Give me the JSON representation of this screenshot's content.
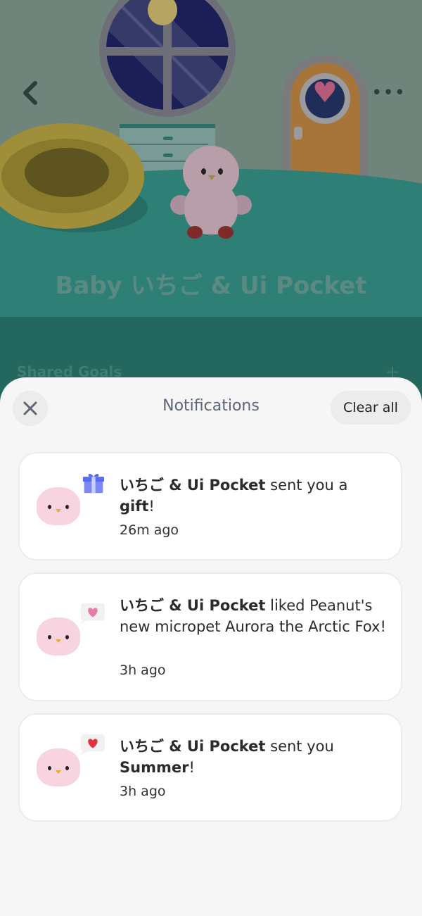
{
  "scene": {
    "title": "Baby いちご & Ui Pocket",
    "section_title": "Shared Goals",
    "section_add": "+",
    "more_icon": "•••"
  },
  "sheet": {
    "title": "Notifications",
    "close_icon": "close-icon",
    "clear_all": "Clear all"
  },
  "notifications": [
    {
      "sender_bold": "いちご & Ui Pocket",
      "text_1": " sent you a ",
      "item_bold": "gift",
      "text_2": "!",
      "time": "26m ago",
      "badge": "gift-icon"
    },
    {
      "sender_bold": "いちご & Ui Pocket",
      "text_1": " liked Peanut's new micropet Aurora the Arctic Fox!",
      "time": "3h ago",
      "badge": "pink-heart-bubble-icon"
    },
    {
      "sender_bold": "いちご & Ui Pocket",
      "text_1": " sent you ",
      "item_bold": "Summer",
      "text_2": "!",
      "time": "3h ago",
      "badge": "red-heart-bubble-icon"
    }
  ],
  "colors": {
    "sheet_bg": "#f6f6f6",
    "card_bg": "#ffffff",
    "title_text": "#5c6675",
    "avatar_pink": "#f8d3e0",
    "gift_blue": "#5a6cf0",
    "heart_pink": "#e77aa6",
    "heart_red": "#e0323f"
  }
}
